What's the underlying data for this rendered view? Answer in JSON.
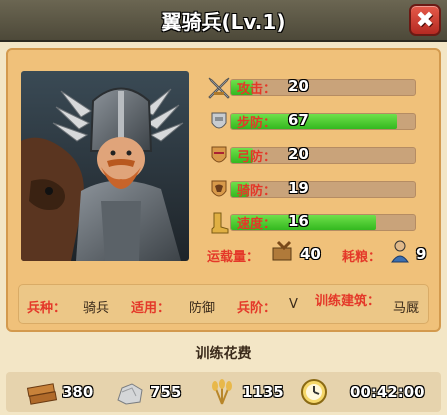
{
  "window": {
    "title": "翼骑兵(Lv.1)",
    "close_icon": "close-icon"
  },
  "portrait": {
    "icon": "winged-hussar-portrait"
  },
  "stats": [
    {
      "icon": "attack-icon",
      "label": "攻击：",
      "value": "20",
      "fill": 0.12
    },
    {
      "icon": "infantry-defense-icon",
      "label": "步防：",
      "value": "67",
      "fill": 0.9
    },
    {
      "icon": "archer-defense-icon",
      "label": "弓防：",
      "value": "20",
      "fill": 0.12
    },
    {
      "icon": "cavalry-defense-icon",
      "label": "骑防：",
      "value": "19",
      "fill": 0.1
    },
    {
      "icon": "speed-icon",
      "label": "速度：",
      "value": "16",
      "fill": 0.79
    }
  ],
  "capacity": {
    "label": "运载量：",
    "value": "40",
    "icon": "cargo-icon"
  },
  "upkeep": {
    "label": "耗粮：",
    "value": "9",
    "icon": "food-consumption-icon"
  },
  "info": {
    "type_label": "兵种：",
    "type_value": "骑兵",
    "suit_label": "适用：",
    "suit_value": "防御",
    "tier_label": "兵阶：",
    "tier_value": "V",
    "building_label": "训练建筑：",
    "building_value": "马厩"
  },
  "cost": {
    "title": "训练花费",
    "wood": "380",
    "stone": "755",
    "food": "1135",
    "time": "00:42:00"
  },
  "colors": {
    "accent_red": "#e43829",
    "bar_green": "#33b81f",
    "panel": "#f0c17a"
  }
}
